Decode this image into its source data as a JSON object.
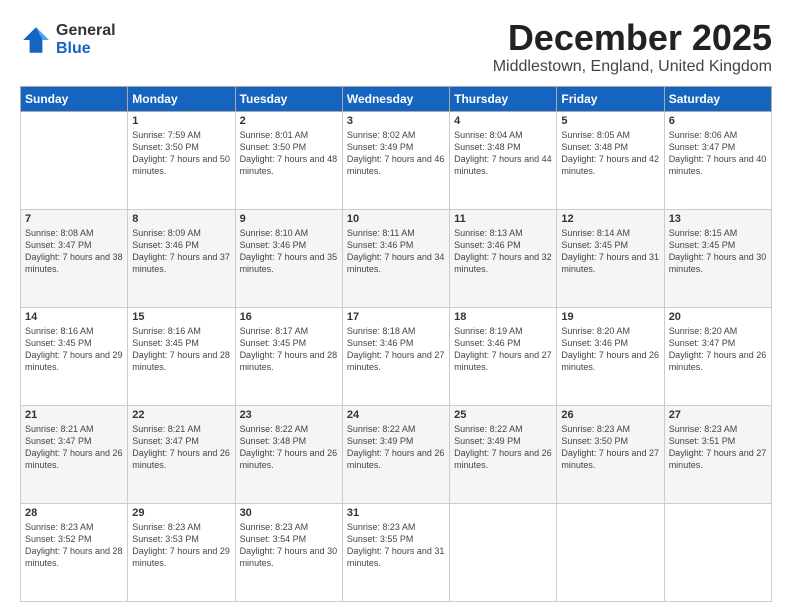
{
  "logo": {
    "general": "General",
    "blue": "Blue"
  },
  "title": "December 2025",
  "location": "Middlestown, England, United Kingdom",
  "header_days": [
    "Sunday",
    "Monday",
    "Tuesday",
    "Wednesday",
    "Thursday",
    "Friday",
    "Saturday"
  ],
  "weeks": [
    [
      {
        "day": "",
        "sunrise": "",
        "sunset": "",
        "daylight": ""
      },
      {
        "day": "1",
        "sunrise": "Sunrise: 7:59 AM",
        "sunset": "Sunset: 3:50 PM",
        "daylight": "Daylight: 7 hours and 50 minutes."
      },
      {
        "day": "2",
        "sunrise": "Sunrise: 8:01 AM",
        "sunset": "Sunset: 3:50 PM",
        "daylight": "Daylight: 7 hours and 48 minutes."
      },
      {
        "day": "3",
        "sunrise": "Sunrise: 8:02 AM",
        "sunset": "Sunset: 3:49 PM",
        "daylight": "Daylight: 7 hours and 46 minutes."
      },
      {
        "day": "4",
        "sunrise": "Sunrise: 8:04 AM",
        "sunset": "Sunset: 3:48 PM",
        "daylight": "Daylight: 7 hours and 44 minutes."
      },
      {
        "day": "5",
        "sunrise": "Sunrise: 8:05 AM",
        "sunset": "Sunset: 3:48 PM",
        "daylight": "Daylight: 7 hours and 42 minutes."
      },
      {
        "day": "6",
        "sunrise": "Sunrise: 8:06 AM",
        "sunset": "Sunset: 3:47 PM",
        "daylight": "Daylight: 7 hours and 40 minutes."
      }
    ],
    [
      {
        "day": "7",
        "sunrise": "Sunrise: 8:08 AM",
        "sunset": "Sunset: 3:47 PM",
        "daylight": "Daylight: 7 hours and 38 minutes."
      },
      {
        "day": "8",
        "sunrise": "Sunrise: 8:09 AM",
        "sunset": "Sunset: 3:46 PM",
        "daylight": "Daylight: 7 hours and 37 minutes."
      },
      {
        "day": "9",
        "sunrise": "Sunrise: 8:10 AM",
        "sunset": "Sunset: 3:46 PM",
        "daylight": "Daylight: 7 hours and 35 minutes."
      },
      {
        "day": "10",
        "sunrise": "Sunrise: 8:11 AM",
        "sunset": "Sunset: 3:46 PM",
        "daylight": "Daylight: 7 hours and 34 minutes."
      },
      {
        "day": "11",
        "sunrise": "Sunrise: 8:13 AM",
        "sunset": "Sunset: 3:46 PM",
        "daylight": "Daylight: 7 hours and 32 minutes."
      },
      {
        "day": "12",
        "sunrise": "Sunrise: 8:14 AM",
        "sunset": "Sunset: 3:45 PM",
        "daylight": "Daylight: 7 hours and 31 minutes."
      },
      {
        "day": "13",
        "sunrise": "Sunrise: 8:15 AM",
        "sunset": "Sunset: 3:45 PM",
        "daylight": "Daylight: 7 hours and 30 minutes."
      }
    ],
    [
      {
        "day": "14",
        "sunrise": "Sunrise: 8:16 AM",
        "sunset": "Sunset: 3:45 PM",
        "daylight": "Daylight: 7 hours and 29 minutes."
      },
      {
        "day": "15",
        "sunrise": "Sunrise: 8:16 AM",
        "sunset": "Sunset: 3:45 PM",
        "daylight": "Daylight: 7 hours and 28 minutes."
      },
      {
        "day": "16",
        "sunrise": "Sunrise: 8:17 AM",
        "sunset": "Sunset: 3:45 PM",
        "daylight": "Daylight: 7 hours and 28 minutes."
      },
      {
        "day": "17",
        "sunrise": "Sunrise: 8:18 AM",
        "sunset": "Sunset: 3:46 PM",
        "daylight": "Daylight: 7 hours and 27 minutes."
      },
      {
        "day": "18",
        "sunrise": "Sunrise: 8:19 AM",
        "sunset": "Sunset: 3:46 PM",
        "daylight": "Daylight: 7 hours and 27 minutes."
      },
      {
        "day": "19",
        "sunrise": "Sunrise: 8:20 AM",
        "sunset": "Sunset: 3:46 PM",
        "daylight": "Daylight: 7 hours and 26 minutes."
      },
      {
        "day": "20",
        "sunrise": "Sunrise: 8:20 AM",
        "sunset": "Sunset: 3:47 PM",
        "daylight": "Daylight: 7 hours and 26 minutes."
      }
    ],
    [
      {
        "day": "21",
        "sunrise": "Sunrise: 8:21 AM",
        "sunset": "Sunset: 3:47 PM",
        "daylight": "Daylight: 7 hours and 26 minutes."
      },
      {
        "day": "22",
        "sunrise": "Sunrise: 8:21 AM",
        "sunset": "Sunset: 3:47 PM",
        "daylight": "Daylight: 7 hours and 26 minutes."
      },
      {
        "day": "23",
        "sunrise": "Sunrise: 8:22 AM",
        "sunset": "Sunset: 3:48 PM",
        "daylight": "Daylight: 7 hours and 26 minutes."
      },
      {
        "day": "24",
        "sunrise": "Sunrise: 8:22 AM",
        "sunset": "Sunset: 3:49 PM",
        "daylight": "Daylight: 7 hours and 26 minutes."
      },
      {
        "day": "25",
        "sunrise": "Sunrise: 8:22 AM",
        "sunset": "Sunset: 3:49 PM",
        "daylight": "Daylight: 7 hours and 26 minutes."
      },
      {
        "day": "26",
        "sunrise": "Sunrise: 8:23 AM",
        "sunset": "Sunset: 3:50 PM",
        "daylight": "Daylight: 7 hours and 27 minutes."
      },
      {
        "day": "27",
        "sunrise": "Sunrise: 8:23 AM",
        "sunset": "Sunset: 3:51 PM",
        "daylight": "Daylight: 7 hours and 27 minutes."
      }
    ],
    [
      {
        "day": "28",
        "sunrise": "Sunrise: 8:23 AM",
        "sunset": "Sunset: 3:52 PM",
        "daylight": "Daylight: 7 hours and 28 minutes."
      },
      {
        "day": "29",
        "sunrise": "Sunrise: 8:23 AM",
        "sunset": "Sunset: 3:53 PM",
        "daylight": "Daylight: 7 hours and 29 minutes."
      },
      {
        "day": "30",
        "sunrise": "Sunrise: 8:23 AM",
        "sunset": "Sunset: 3:54 PM",
        "daylight": "Daylight: 7 hours and 30 minutes."
      },
      {
        "day": "31",
        "sunrise": "Sunrise: 8:23 AM",
        "sunset": "Sunset: 3:55 PM",
        "daylight": "Daylight: 7 hours and 31 minutes."
      },
      {
        "day": "",
        "sunrise": "",
        "sunset": "",
        "daylight": ""
      },
      {
        "day": "",
        "sunrise": "",
        "sunset": "",
        "daylight": ""
      },
      {
        "day": "",
        "sunrise": "",
        "sunset": "",
        "daylight": ""
      }
    ]
  ]
}
